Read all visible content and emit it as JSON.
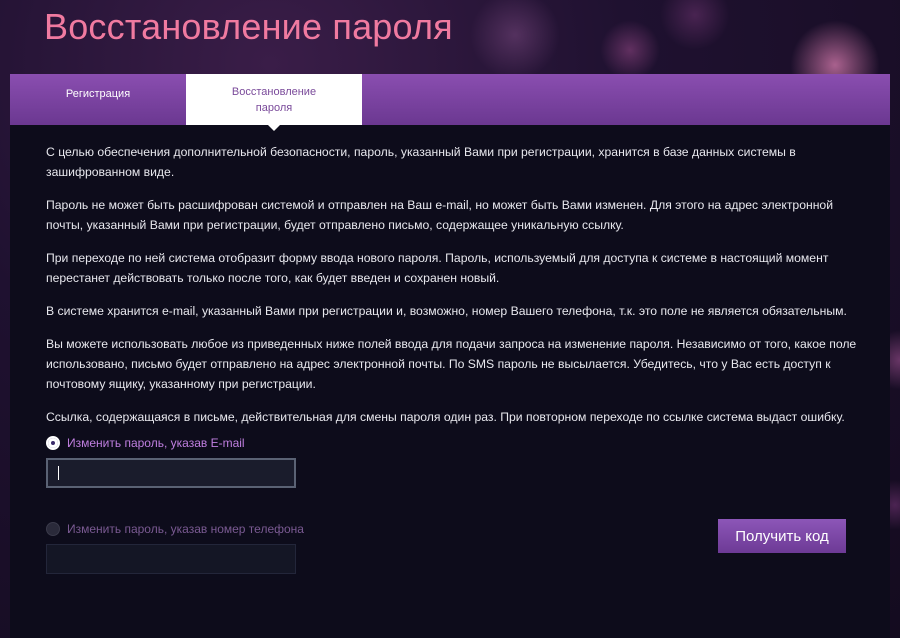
{
  "page": {
    "title": "Восстановление пароля"
  },
  "tabs": [
    {
      "label": "Регистрация",
      "active": false
    },
    {
      "label": "Восстановление пароля",
      "active": true
    }
  ],
  "content": {
    "paragraphs": [
      "С целью обеспечения дополнительной безопасности, пароль, указанный Вами при регистрации, хранится в базе данных системы в зашифрованном виде.",
      "Пароль не может быть расшифрован системой и отправлен на Ваш e-mail, но может быть Вами изменен. Для этого на адрес электронной почты, указанный Вами при регистрации, будет отправлено письмо, содержащее уникальную ссылку.",
      "При переходе по ней система отобразит форму ввода нового пароля. Пароль, используемый для доступа к системе в настоящий момент перестанет действовать только после того, как будет введен и сохранен новый.",
      "В системе хранится e-mail, указанный Вами при регистрации и, возможно, номер Вашего телефона, т.к. это поле не является обязательным.",
      "Вы можете использовать любое из приведенных ниже полей ввода для подачи запроса на изменение пароля. Независимо от того, какое поле использовано, письмо будет отправлено на адрес электронной почты. По SMS пароль не высылается. Убедитесь, что у Вас есть доступ к почтовому ящику, указанному при регистрации.",
      "Ссылка, содержащаяся в письме, действительная для смены пароля один раз. При повторном переходе по ссылке система выдаст ошибку."
    ]
  },
  "form": {
    "email_option": {
      "label": "Изменить пароль, указав E-mail",
      "selected": true,
      "value": ""
    },
    "phone_option": {
      "label": "Изменить пароль, указав номер телефона",
      "selected": false,
      "value": ""
    },
    "submit_label": "Получить код"
  },
  "colors": {
    "accent": "#8a4eb0",
    "title": "#f07aa0",
    "background": "#0d0c1b"
  }
}
